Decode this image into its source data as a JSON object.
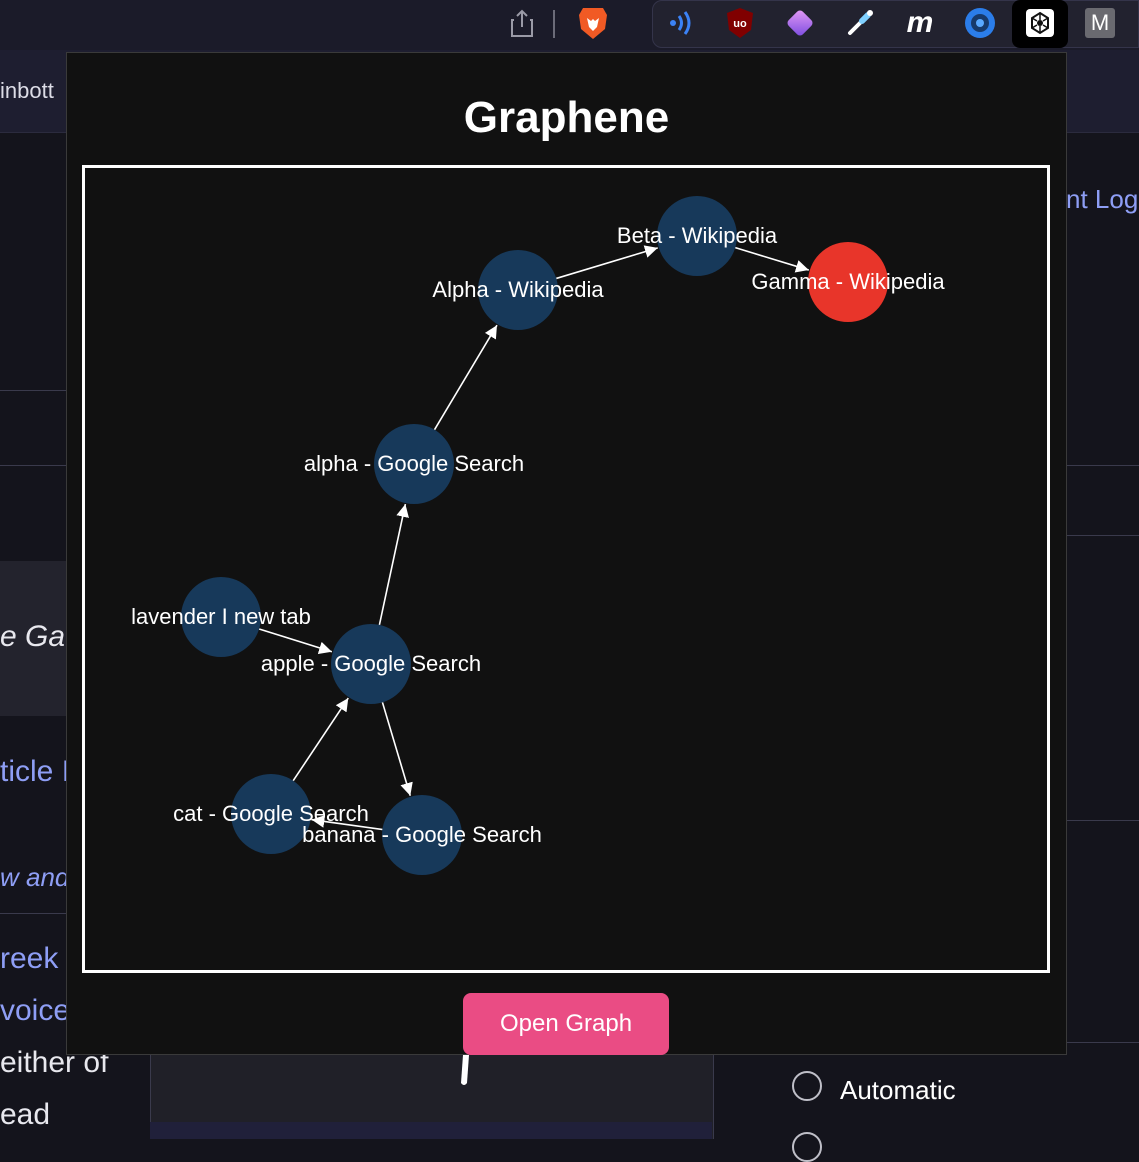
{
  "browser": {
    "extensions": [
      {
        "icon": "share-icon"
      },
      {
        "icon": "brave-lion-icon",
        "color": "#f15a24"
      },
      {
        "icon": "wave-signal-icon",
        "color": "#3b82f6"
      },
      {
        "icon": "ublock-origin-icon",
        "color": "#800000",
        "label": "uo"
      },
      {
        "icon": "gem-diamond-icon",
        "color": "#b06ae8"
      },
      {
        "icon": "eyedropper-icon"
      },
      {
        "icon": "m-script-icon",
        "label": "m"
      },
      {
        "icon": "blue-circle-lens-icon",
        "color": "#2b7de9"
      },
      {
        "icon": "graphene-hexagon-icon"
      },
      {
        "icon": "m-square-icon",
        "label": "M"
      }
    ]
  },
  "background_page": {
    "tab_fragment": "inbott",
    "right_link_fragment": "nt  Log",
    "middle_fragment": "e Ga",
    "article_fragment": "ticle I",
    "italic_fragment": "w and",
    "greek_fragment": "reek",
    "voice_fragment": "voice",
    "either_fragment": "either of",
    "read_fragment": "ead",
    "automatic_label": "Automatic"
  },
  "popup": {
    "title": "Graphene",
    "open_button_label": "Open Graph"
  },
  "graph": {
    "node_color": "#17395a",
    "current_node_color": "#e8352a",
    "edge_color": "#ffffff",
    "nodes": [
      {
        "id": "beta",
        "label": "Beta - Wikipedia",
        "current": false
      },
      {
        "id": "gamma",
        "label": "Gamma - Wikipedia",
        "current": true
      },
      {
        "id": "alpha_wiki",
        "label": "Alpha - Wikipedia",
        "current": false
      },
      {
        "id": "alpha_search",
        "label": "alpha - Google Search",
        "current": false
      },
      {
        "id": "lavender",
        "label": "lavender I new tab",
        "current": false
      },
      {
        "id": "apple",
        "label": "apple - Google Search",
        "current": false
      },
      {
        "id": "cat",
        "label": "cat - Google Search",
        "current": false
      },
      {
        "id": "banana",
        "label": "banana - Google Search",
        "current": false
      }
    ],
    "edges": [
      {
        "from": "alpha_wiki",
        "to": "beta"
      },
      {
        "from": "beta",
        "to": "gamma"
      },
      {
        "from": "alpha_search",
        "to": "alpha_wiki"
      },
      {
        "from": "apple",
        "to": "alpha_search"
      },
      {
        "from": "lavender",
        "to": "apple"
      },
      {
        "from": "apple",
        "to": "banana"
      },
      {
        "from": "cat",
        "to": "apple"
      },
      {
        "from": "banana",
        "to": "cat"
      }
    ]
  }
}
